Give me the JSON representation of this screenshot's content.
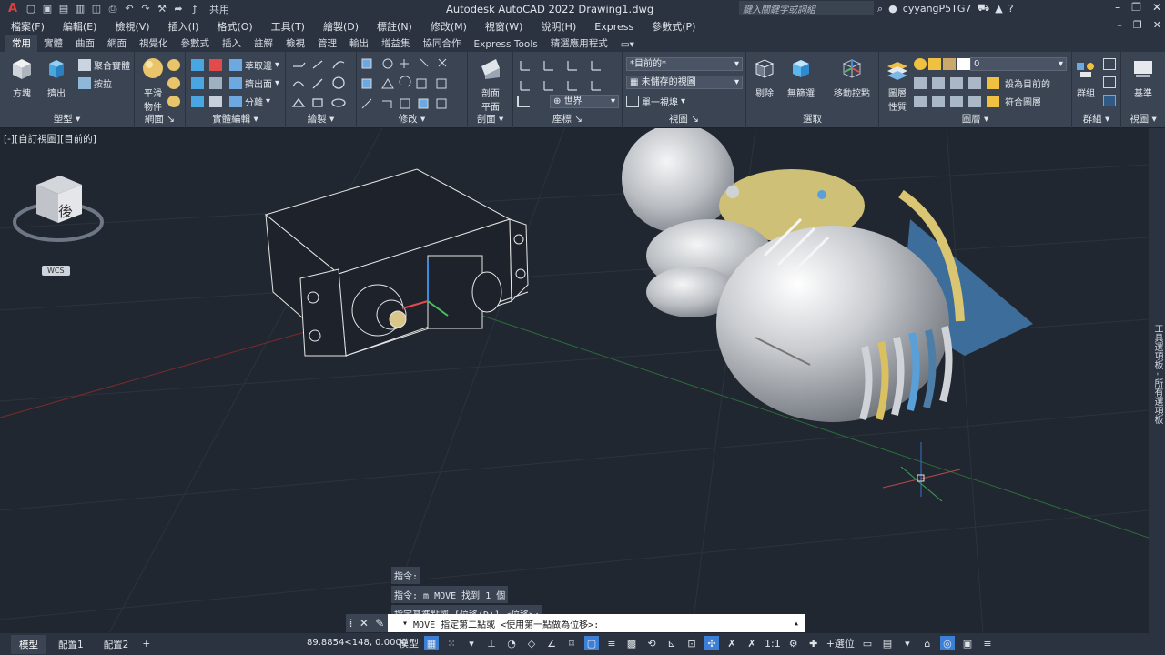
{
  "app": {
    "title": "Autodesk AutoCAD 2022    Drawing1.dwg",
    "search_placeholder": "鍵入關鍵字或詞組",
    "user": "cyyangP5TG7",
    "share_label": "共用",
    "logo": "A"
  },
  "menu": [
    "檔案(F)",
    "編輯(E)",
    "檢視(V)",
    "插入(I)",
    "格式(O)",
    "工具(T)",
    "繪製(D)",
    "標註(N)",
    "修改(M)",
    "視窗(W)",
    "說明(H)",
    "Express",
    "參數式(P)"
  ],
  "tabs": [
    "常用",
    "實體",
    "曲面",
    "網面",
    "視覺化",
    "參數式",
    "插入",
    "註解",
    "檢視",
    "管理",
    "輸出",
    "增益集",
    "協同合作",
    "Express Tools",
    "精選應用程式"
  ],
  "ribbon": {
    "modeling": {
      "label": "塑型",
      "box": "方塊",
      "extrude": "擠出",
      "union": "聚合實體",
      "presspull": "按拉"
    },
    "mesh": {
      "label": "網面",
      "smooth": "平滑",
      "smooth2": "物件"
    },
    "solid_edit": {
      "label": "實體編輯",
      "extract_edges": "萃取邊",
      "extrude_faces": "擠出面",
      "separate": "分離"
    },
    "draw": {
      "label": "繪製"
    },
    "modify": {
      "label": "修改"
    },
    "section": {
      "label": "剖面",
      "plane": "剖面",
      "plane2": "平面"
    },
    "coordinates": {
      "label": "座標",
      "world": "世界"
    },
    "view": {
      "label": "視圖",
      "visual_style": "*目前的*",
      "named_view": "未儲存的視圖",
      "single_viewport": "單一視埠"
    },
    "selection": {
      "label": "選取",
      "cull": "剔除",
      "no_filter": "無篩選",
      "gizmo": "移動控點"
    },
    "layers": {
      "label": "圖層",
      "layer_props": "圖層",
      "layer_props2": "性質",
      "layer_value": "0",
      "set_current": "設為目前的",
      "match_layer": "符合圖層"
    },
    "groups": {
      "label": "群組",
      "group": "群組"
    },
    "view2": {
      "label": "視圖",
      "base": "基準"
    }
  },
  "viewport": {
    "label": "[-][自訂視圖][目前的]",
    "viewcube_face": "後",
    "wcs": "WCS"
  },
  "right_strip": "工具選項板 - 所有選項板",
  "command": {
    "history": [
      "指令:",
      "指令: m MOVE 找到 1 個",
      "指定基準點或 [位移(D)] <位移>:"
    ],
    "current": "MOVE 指定第二點或 <使用第一點做為位移>:"
  },
  "status": {
    "tabs": [
      "模型",
      "配置1",
      "配置2"
    ],
    "coords": "89.8854<148, 0.0000",
    "model": "模型",
    "scale": "1:1",
    "plus_select": "+選位"
  }
}
